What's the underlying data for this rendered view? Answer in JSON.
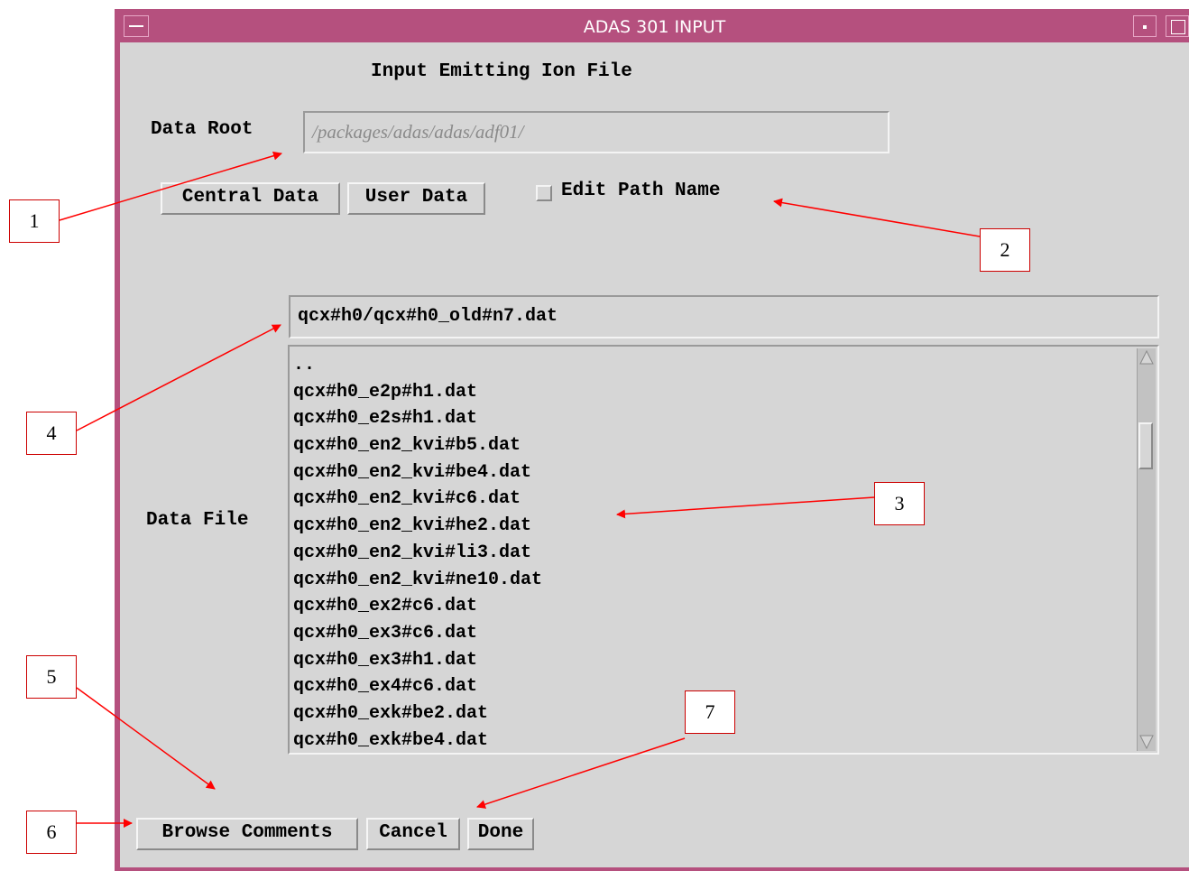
{
  "window": {
    "title": "ADAS 301 INPUT"
  },
  "panel": {
    "heading": "Input Emitting Ion File",
    "data_root_label": "Data Root",
    "data_root_value": "/packages/adas/adas/adf01/",
    "central_data_button": "Central Data",
    "user_data_button": "User Data",
    "edit_path_label": "Edit Path Name",
    "edit_path_checked": false,
    "data_file_label": "Data File",
    "data_file_value": "qcx#h0/qcx#h0_old#n7.dat"
  },
  "file_list": {
    "items": [
      "..",
      "qcx#h0_e2p#h1.dat",
      "qcx#h0_e2s#h1.dat",
      "qcx#h0_en2_kvi#b5.dat",
      "qcx#h0_en2_kvi#be4.dat",
      "qcx#h0_en2_kvi#c6.dat",
      "qcx#h0_en2_kvi#he2.dat",
      "qcx#h0_en2_kvi#li3.dat",
      "qcx#h0_en2_kvi#ne10.dat",
      "qcx#h0_ex2#c6.dat",
      "qcx#h0_ex3#c6.dat",
      "qcx#h0_ex3#h1.dat",
      "qcx#h0_ex4#c6.dat",
      "qcx#h0_exk#be2.dat",
      "qcx#h0_exk#be4.dat"
    ]
  },
  "footer": {
    "browse_comments_button": "Browse Comments",
    "cancel_button": "Cancel",
    "done_button": "Done"
  },
  "annotations": {
    "c1": "1",
    "c2": "2",
    "c3": "3",
    "c4": "4",
    "c5": "5",
    "c6": "6",
    "c7": "7",
    "arrow_color": "#ff0000"
  }
}
